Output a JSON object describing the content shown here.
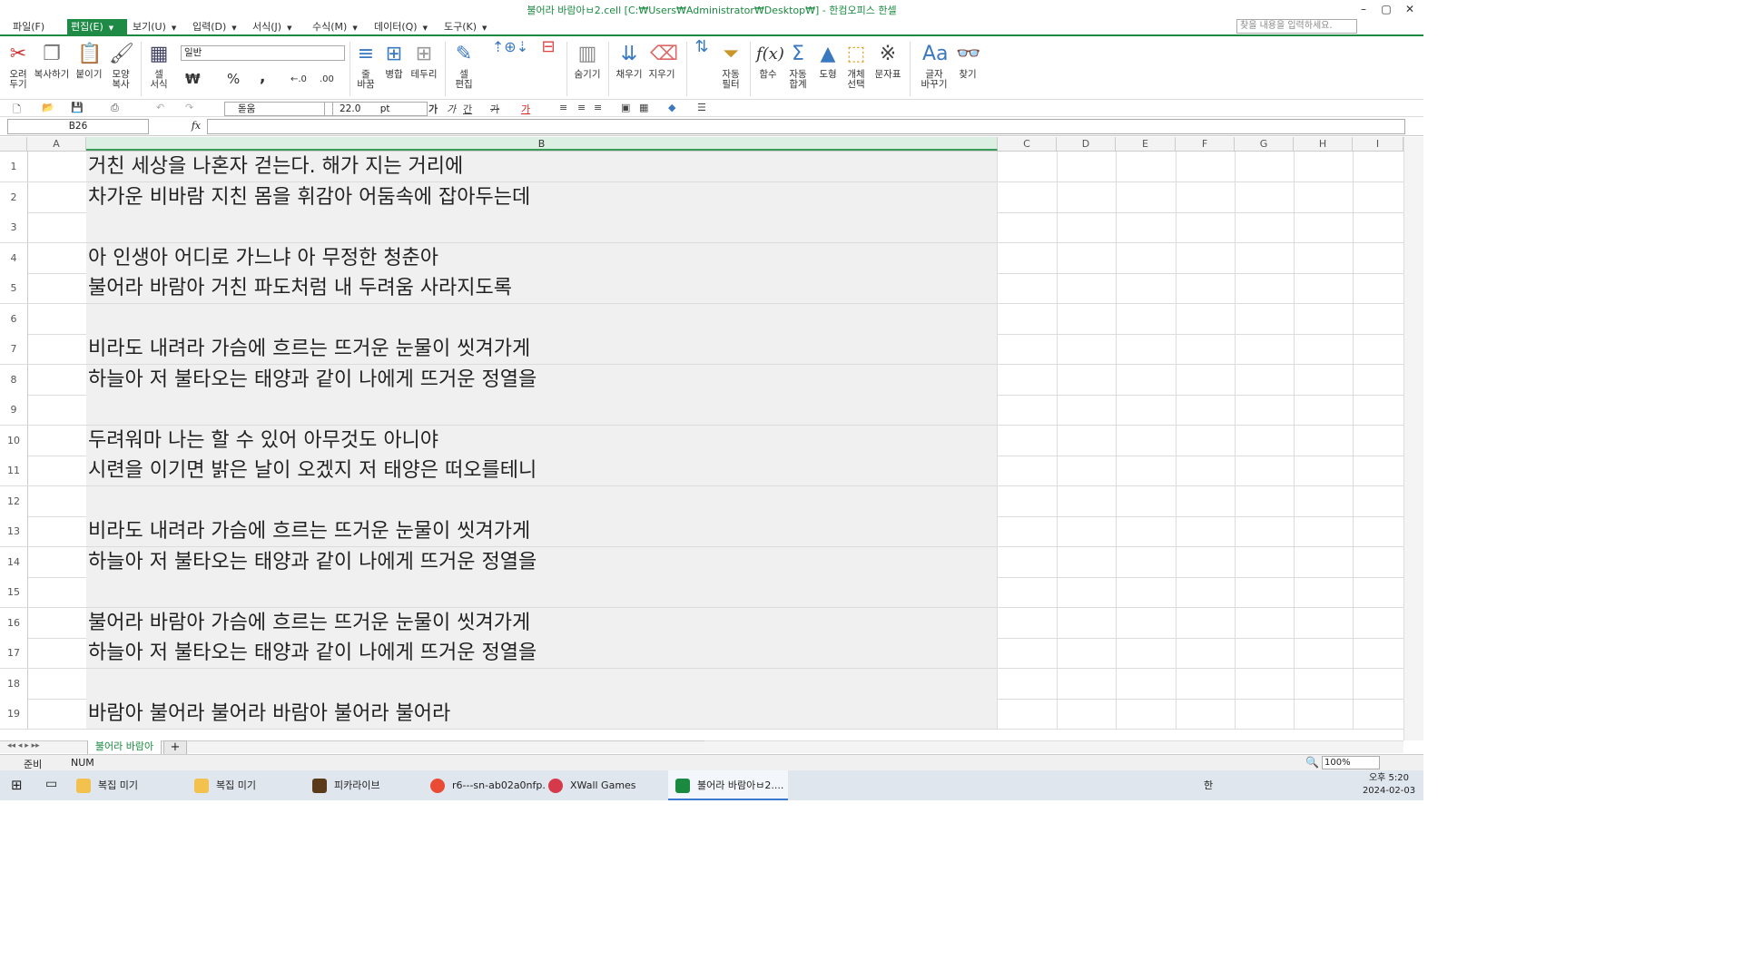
{
  "window": {
    "title": "불어라 바람아ㅂ2.cell [C:₩Users₩Administrator₩Desktop₩] - 한컴오피스 한셀",
    "min": "–",
    "restore": "▢",
    "close": "✕"
  },
  "menu": {
    "file": "파일(F)",
    "edit": "편집(E)",
    "view": "보기(U)",
    "input": "입력(D)",
    "format": "서식(J)",
    "formula": "수식(M)",
    "data": "데이터(Q)",
    "tools": "도구(K)",
    "search_placeholder": "찾을 내용을 입력하세요."
  },
  "ribbon": {
    "cut": "오려\n두기",
    "copy": "복사하기",
    "paste": "붙이기",
    "format_copy": "모양\n복사",
    "cell_format": "셀\n서식",
    "number_format": "일반",
    "wrap": "줄\n바꿈",
    "merge": "병합",
    "border": "테두리",
    "cell_edit": "셀\n편집",
    "hide": "숨기기",
    "fill": "채우기",
    "clear": "지우기",
    "auto_filter": "자동\n필터",
    "function": "함수",
    "auto_sum": "자동\n합계",
    "shape": "도형",
    "object_select": "개체\n선택",
    "symbol": "문자표",
    "replace": "글자\n바꾸기",
    "find": "찾기",
    "currency": "₩",
    "percent": "%",
    "comma": ","
  },
  "toolbar": {
    "font": "돋움",
    "size": "22.0",
    "unit": "pt",
    "bold": "가",
    "italic": "가",
    "underline": "간",
    "strike": "가",
    "color": "가"
  },
  "formula_bar": {
    "cell_ref": "B26",
    "fx": "fx",
    "value": ""
  },
  "columns": [
    "A",
    "B",
    "C",
    "D",
    "E",
    "F",
    "G",
    "H",
    "I"
  ],
  "rows": [
    {
      "n": "1",
      "b": "거친 세상을 나혼자 걷는다. 해가 지는 거리에"
    },
    {
      "n": "2",
      "b": "차가운 비바람 지친 몸을 휘감아 어둠속에 잡아두는데"
    },
    {
      "n": "3",
      "b": ""
    },
    {
      "n": "4",
      "b": "아 인생아 어디로 가느냐 아 무정한 청춘아"
    },
    {
      "n": "5",
      "b": "불어라 바람아 거친 파도처럼 내 두려움 사라지도록"
    },
    {
      "n": "6",
      "b": ""
    },
    {
      "n": "7",
      "b": "비라도 내려라 가슴에 흐르는 뜨거운 눈물이 씻겨가게"
    },
    {
      "n": "8",
      "b": "하늘아 저 불타오는 태양과 같이 나에게 뜨거운 정열을"
    },
    {
      "n": "9",
      "b": ""
    },
    {
      "n": "10",
      "b": "두려워마 나는 할 수 있어 아무것도 아니야"
    },
    {
      "n": "11",
      "b": "시련을 이기면 밝은 날이 오겠지 저 태양은 떠오를테니"
    },
    {
      "n": "12",
      "b": ""
    },
    {
      "n": "13",
      "b": "비라도 내려라 가슴에 흐르는 뜨거운 눈물이 씻겨가게"
    },
    {
      "n": "14",
      "b": "하늘아 저 불타오는 태양과 같이 나에게 뜨거운 정열을"
    },
    {
      "n": "15",
      "b": ""
    },
    {
      "n": "16",
      "b": "불어라 바람아 가슴에 흐르는 뜨거운 눈물이 씻겨가게"
    },
    {
      "n": "17",
      "b": "하늘아 저 불타오는 태양과 같이 나에게 뜨거운 정열을"
    },
    {
      "n": "18",
      "b": ""
    },
    {
      "n": "19",
      "b": "바람아 불어라 불어라 바람아 불어라 불어라"
    }
  ],
  "sheet_tab": "불어라 바람아",
  "status": {
    "ready": "준비",
    "num": "NUM",
    "zoom": "100%"
  },
  "taskbar": {
    "items": [
      "복집 미기",
      "복집 미기",
      "피카라이브",
      "r6---sn-ab02a0nfp...",
      "XWall Games",
      "불어라 바람아ㅂ2...."
    ],
    "ime": "한",
    "time": "오후 5:20",
    "date": "2024-02-03"
  },
  "accent": "#1a8a40"
}
